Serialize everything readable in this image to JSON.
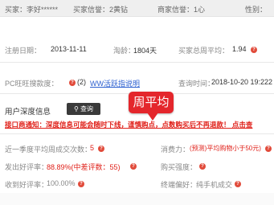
{
  "header": {
    "seller_label": "买家：李好******",
    "credit_label": "买家信誉：2黄钻",
    "shop_credit_label": "商家信誉：1心",
    "gender_label": "性别："
  },
  "info": {
    "register_label": "注册日期：",
    "register_value": "2013-11-11",
    "age_label": "淘龄：",
    "age_value": "1804天",
    "weekly_avg_label": "买家总周平均：",
    "weekly_avg_value": "1.94"
  },
  "pc_row": {
    "pc_label": "PC旺旺搜款度：",
    "count_text": "(2)",
    "link_text": "WW活跃指说明",
    "query_time_label": "查询时间：",
    "query_time_value": "2018-10-20 19:222"
  },
  "deep_info": {
    "title": "用户深度信息",
    "search_button": "查询",
    "search_icon": "search-icon"
  },
  "callout": {
    "text": "周平均",
    "color": "#e4262c"
  },
  "notice": {
    "text": "接口商通知：深度信息可能会随时下线，谨慎购点，点数购买后不再退款！ 点击查"
  },
  "stats": [
    {
      "label": "近一季度平均周成交次数：",
      "value": "5",
      "unit": "",
      "icon": "help-icon"
    },
    {
      "label": "消费力：",
      "value": "(预测)平均购物小于50元)",
      "unit": "",
      "icon": "help-icon"
    },
    {
      "label": "发出好评率：",
      "value": "88.89%(中差评数：55)",
      "unit": "",
      "icon": "help-icon"
    },
    {
      "label": "购买强度：",
      "value": "",
      "unit": "",
      "icon": "help-icon"
    },
    {
      "label": "收到好评率：",
      "value": "100.00%",
      "unit": "",
      "icon": "help-icon"
    },
    {
      "label": "终端偏好：",
      "value": "纯手机成交",
      "unit": "",
      "icon": "help-icon"
    }
  ],
  "colors": {
    "accent": "#e0211a",
    "link": "#2b5fd0",
    "button": "#3a3a3a"
  }
}
